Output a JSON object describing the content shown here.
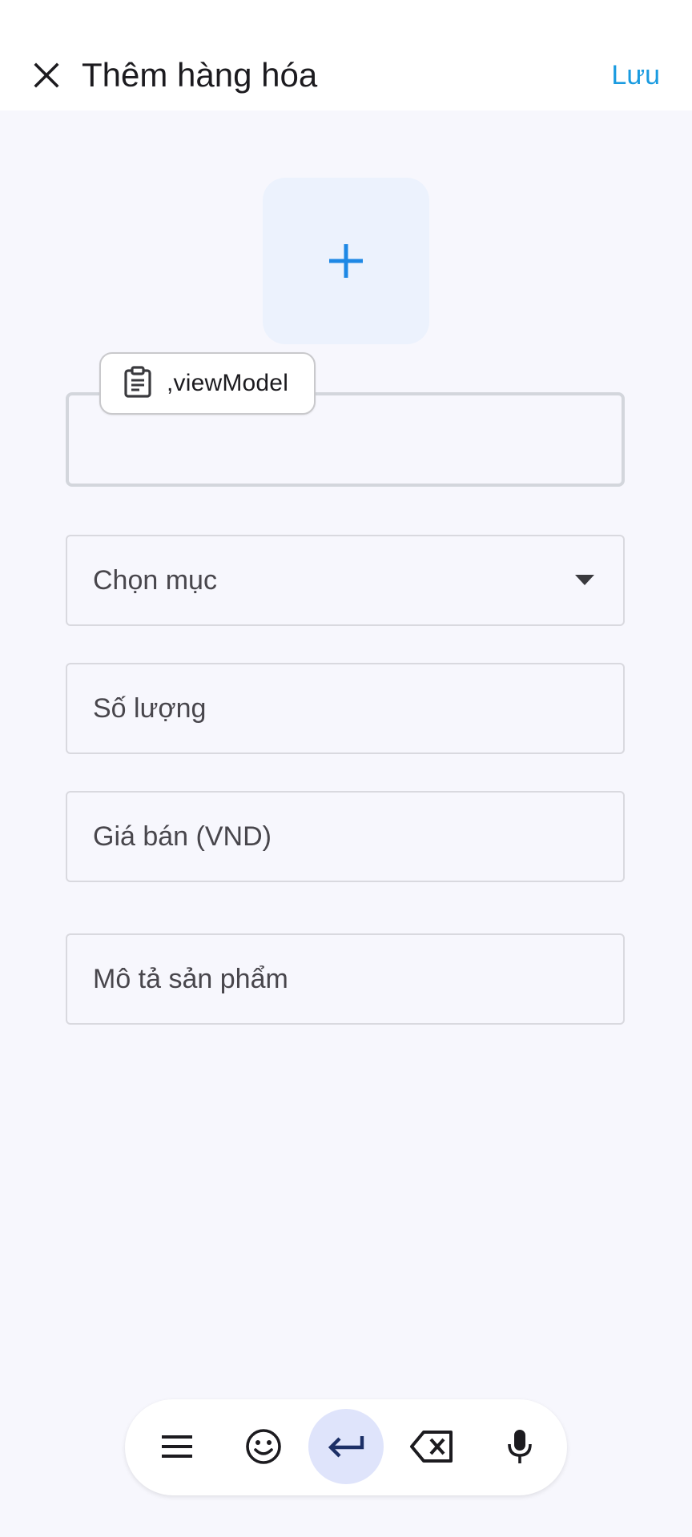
{
  "header": {
    "title": "Thêm hàng hóa",
    "save_label": "Lưu"
  },
  "image_picker": {
    "icon": "plus-icon"
  },
  "clipboard_suggestion": {
    "text": ",viewModel",
    "icon": "clipboard-icon"
  },
  "form": {
    "name_field": {
      "value": "",
      "placeholder": ""
    },
    "category_select": {
      "placeholder": "Chọn mục"
    },
    "quantity_field": {
      "placeholder": "Số lượng"
    },
    "price_field": {
      "placeholder": "Giá bán (VND)"
    },
    "description_field": {
      "placeholder": "Mô tả sản phẩm"
    }
  },
  "keyboard_toolbar": {
    "buttons": [
      "menu-icon",
      "emoji-icon",
      "enter-icon",
      "backspace-icon",
      "microphone-icon"
    ]
  },
  "colors": {
    "accent": "#1a9be0",
    "plus": "#1e88e5",
    "picker_bg": "#ecf2fd",
    "page_bg": "#f7f7fd"
  }
}
